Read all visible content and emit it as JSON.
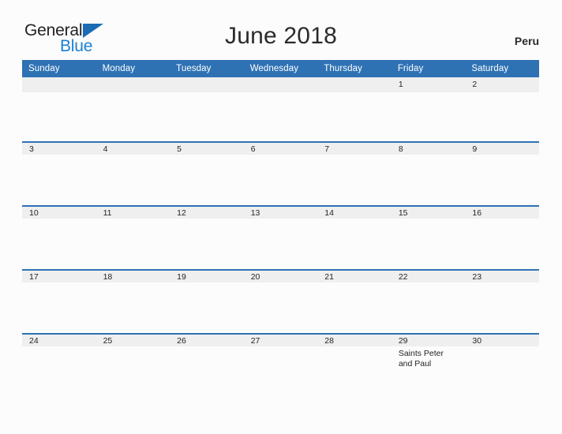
{
  "brand": {
    "name_top": "General",
    "name_bottom": "Blue",
    "flag_icon": "flag-icon",
    "accent_blue": "#1b7fd4",
    "dark": "#231f20"
  },
  "header": {
    "title": "June 2018",
    "country": "Peru"
  },
  "theme": {
    "header_blue": "#2f72b4",
    "date_strip_gray": "#efefef",
    "page_background": "#fcfcfc",
    "text_color": "#231f20"
  },
  "calendar": {
    "month": "June",
    "year": "2018",
    "weekday_headers": [
      "Sunday",
      "Monday",
      "Tuesday",
      "Wednesday",
      "Thursday",
      "Friday",
      "Saturday"
    ],
    "weeks": [
      [
        {
          "date": "",
          "events": []
        },
        {
          "date": "",
          "events": []
        },
        {
          "date": "",
          "events": []
        },
        {
          "date": "",
          "events": []
        },
        {
          "date": "",
          "events": []
        },
        {
          "date": "1",
          "events": []
        },
        {
          "date": "2",
          "events": []
        }
      ],
      [
        {
          "date": "3",
          "events": []
        },
        {
          "date": "4",
          "events": []
        },
        {
          "date": "5",
          "events": []
        },
        {
          "date": "6",
          "events": []
        },
        {
          "date": "7",
          "events": []
        },
        {
          "date": "8",
          "events": []
        },
        {
          "date": "9",
          "events": []
        }
      ],
      [
        {
          "date": "10",
          "events": []
        },
        {
          "date": "11",
          "events": []
        },
        {
          "date": "12",
          "events": []
        },
        {
          "date": "13",
          "events": []
        },
        {
          "date": "14",
          "events": []
        },
        {
          "date": "15",
          "events": []
        },
        {
          "date": "16",
          "events": []
        }
      ],
      [
        {
          "date": "17",
          "events": []
        },
        {
          "date": "18",
          "events": []
        },
        {
          "date": "19",
          "events": []
        },
        {
          "date": "20",
          "events": []
        },
        {
          "date": "21",
          "events": []
        },
        {
          "date": "22",
          "events": []
        },
        {
          "date": "23",
          "events": []
        }
      ],
      [
        {
          "date": "24",
          "events": []
        },
        {
          "date": "25",
          "events": []
        },
        {
          "date": "26",
          "events": []
        },
        {
          "date": "27",
          "events": []
        },
        {
          "date": "28",
          "events": []
        },
        {
          "date": "29",
          "events": [
            "Saints Peter and Paul"
          ]
        },
        {
          "date": "30",
          "events": []
        }
      ]
    ]
  }
}
